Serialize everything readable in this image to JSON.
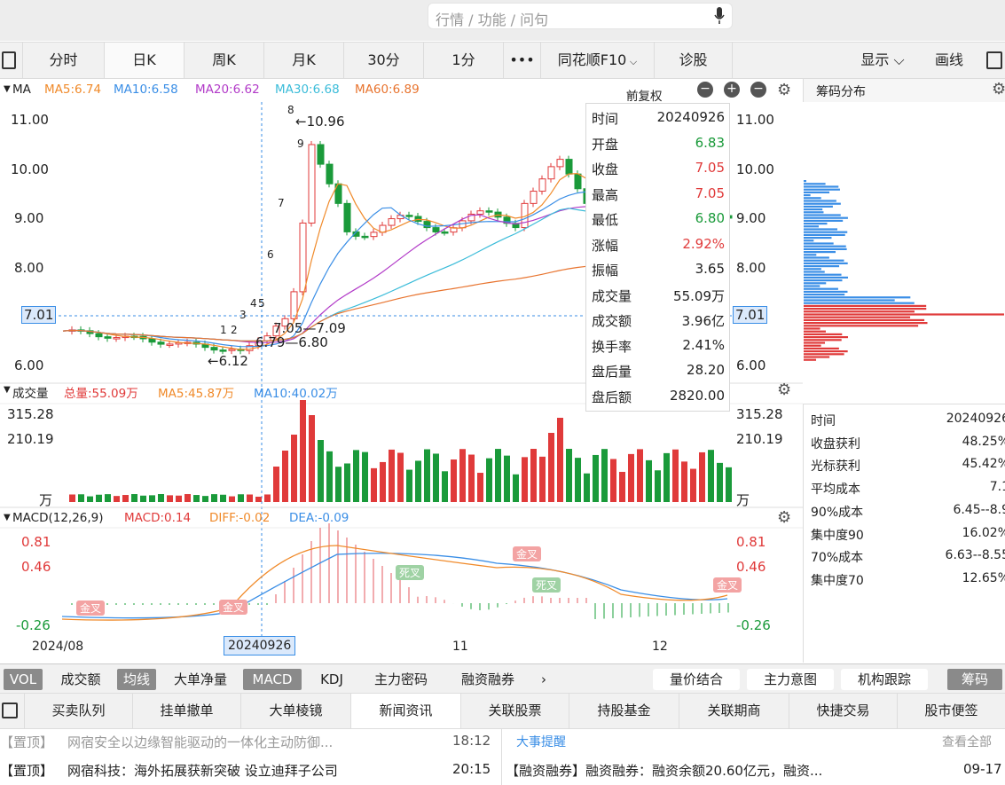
{
  "search": {
    "placeholder": "行情 / 功能 / 问句"
  },
  "period_tabs": [
    "分时",
    "日K",
    "周K",
    "月K",
    "30分",
    "1分",
    "•••",
    "同花顺F10",
    "诊股"
  ],
  "active_period": "日K",
  "toolbar_right": {
    "display": "显示",
    "draw": "画线"
  },
  "ma": {
    "title": "MA",
    "items": [
      {
        "label": "MA5:6.74",
        "color": "#f08a2a"
      },
      {
        "label": "MA10:6.58",
        "color": "#3a8ee6"
      },
      {
        "label": "MA20:6.62",
        "color": "#b23bc8"
      },
      {
        "label": "MA30:6.68",
        "color": "#3bbcd9"
      },
      {
        "label": "MA60:6.89",
        "color": "#e8742f"
      }
    ],
    "adjust": "前复权"
  },
  "price_axis": [
    "11.00",
    "10.00",
    "9.00",
    "8.00",
    "7.01",
    "6.00"
  ],
  "annotations": {
    "high": "←10.96",
    "low": "←6.12",
    "range1": "7.05—7.09",
    "range2": "6.79—6.80",
    "nums": [
      "8",
      "9",
      "7",
      "6",
      "4",
      "5",
      "3",
      "2",
      "1"
    ]
  },
  "popup": [
    {
      "k": "时间",
      "v": "20240926",
      "c": "#222"
    },
    {
      "k": "开盘",
      "v": "6.83",
      "c": "#1a9a3a"
    },
    {
      "k": "收盘",
      "v": "7.05",
      "c": "#e03a3a"
    },
    {
      "k": "最高",
      "v": "7.05",
      "c": "#e03a3a"
    },
    {
      "k": "最低",
      "v": "6.80",
      "c": "#1a9a3a"
    },
    {
      "k": "涨幅",
      "v": "2.92%",
      "c": "#e03a3a"
    },
    {
      "k": "振幅",
      "v": "3.65",
      "c": "#222"
    },
    {
      "k": "成交量",
      "v": "55.09万",
      "c": "#222"
    },
    {
      "k": "成交额",
      "v": "3.96亿",
      "c": "#222"
    },
    {
      "k": "换手率",
      "v": "2.41%",
      "c": "#222"
    },
    {
      "k": "盘后量",
      "v": "28.20",
      "c": "#222"
    },
    {
      "k": "盘后额",
      "v": "2820.00",
      "c": "#222"
    }
  ],
  "volume": {
    "title": "成交量",
    "total": "总量:55.09万",
    "ma5": "MA5:45.87万",
    "ma10": "MA10:40.02万",
    "axis": [
      "315.28",
      "210.19",
      "万"
    ]
  },
  "macd": {
    "title": "MACD(12,26,9)",
    "macd": "MACD:0.14",
    "diff": "DIFF:-0.02",
    "dea": "DEA:-0.09",
    "axis": [
      "0.81",
      "0.46",
      "-0.26"
    ],
    "cross_gold": "金叉",
    "cross_dead": "死叉"
  },
  "date_axis": {
    "left": "2024/08",
    "cursor": "20240926",
    "m11": "11",
    "m12": "12"
  },
  "chip": {
    "title": "筹码分布",
    "stats": [
      {
        "k": "时间",
        "v": "20240926"
      },
      {
        "k": "收盘获利",
        "v": "48.25%"
      },
      {
        "k": "光标获利",
        "v": "45.42%"
      },
      {
        "k": "平均成本",
        "v": "7.1"
      },
      {
        "k": "90%成本",
        "v": "6.45--8.9"
      },
      {
        "k": "集中度90",
        "v": "16.02%"
      },
      {
        "k": "70%成本",
        "v": "6.63--8.55"
      },
      {
        "k": "集中度70",
        "v": "12.65%"
      }
    ]
  },
  "indicator_tabs": [
    "VOL",
    "成交额",
    "均线",
    "大单净量",
    "MACD",
    "KDJ",
    "主力密码",
    "融资融券",
    "›"
  ],
  "indicator_right": [
    "量价结合",
    "主力意图",
    "机构跟踪",
    "筹码"
  ],
  "bottom_tabs": [
    "买卖队列",
    "挂单撤单",
    "大单棱镜",
    "新闻资讯",
    "关联股票",
    "持股基金",
    "关联期商",
    "快捷交易",
    "股市便签"
  ],
  "news": [
    {
      "tag": "【置顶】",
      "text": "网宿安全以边缘智能驱动的一体化主动防御...",
      "time": "18:12"
    },
    {
      "tag": "【置顶】",
      "text": "网宿科技：海外拓展获新突破 设立迪拜子公司",
      "time": "20:15"
    }
  ],
  "events": {
    "title": "大事提醒",
    "more": "查看全部",
    "item": "【融资融券】融资融券：融资余额20.60亿元，融资...",
    "date": "09-17"
  }
}
